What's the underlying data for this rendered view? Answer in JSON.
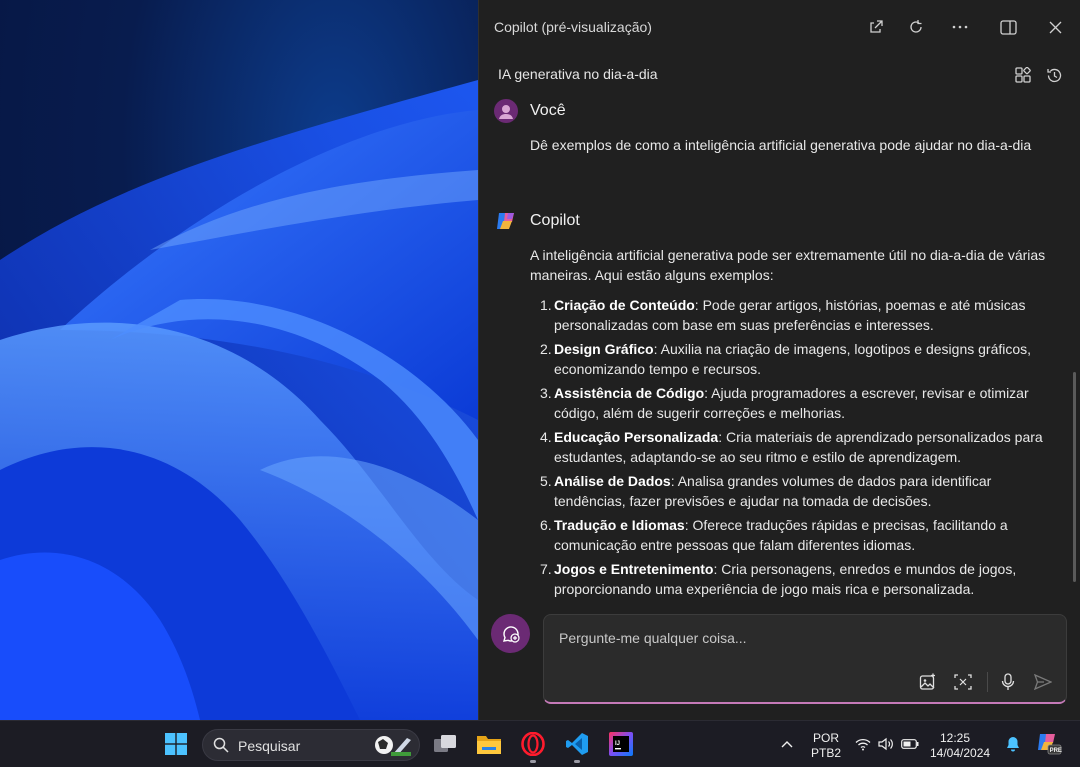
{
  "copilot": {
    "window_title": "Copilot (pré-visualização)",
    "conversation_title": "IA generativa no dia-a-dia",
    "user": {
      "name": "Você",
      "message": "Dê exemplos de como a inteligência artificial generativa pode ajudar no dia-a-dia"
    },
    "assistant": {
      "name": "Copilot",
      "intro": "A inteligência artificial generativa pode ser extremamente útil no dia-a-dia de várias maneiras. Aqui estão alguns exemplos:",
      "items": [
        {
          "num": "1.",
          "title": "Criação de Conteúdo",
          "text": ": Pode gerar artigos, histórias, poemas e até músicas personalizadas com base em suas preferências e interesses."
        },
        {
          "num": "2.",
          "title": "Design Gráfico",
          "text": ": Auxilia na criação de imagens, logotipos e designs gráficos, economizando tempo e recursos."
        },
        {
          "num": "3.",
          "title": "Assistência de Código",
          "text": ": Ajuda programadores a escrever, revisar e otimizar código, além de sugerir correções e melhorias."
        },
        {
          "num": "4.",
          "title": "Educação Personalizada",
          "text": ": Cria materiais de aprendizado personalizados para estudantes, adaptando-se ao seu ritmo e estilo de aprendizagem."
        },
        {
          "num": "5.",
          "title": "Análise de Dados",
          "text": ": Analisa grandes volumes de dados para identificar tendências, fazer previsões e ajudar na tomada de decisões."
        },
        {
          "num": "6.",
          "title": "Tradução e Idiomas",
          "text": ": Oferece traduções rápidas e precisas, facilitando a comunicação entre pessoas que falam diferentes idiomas."
        },
        {
          "num": "7.",
          "title": "Jogos e Entretenimento",
          "text": ": Cria personagens, enredos e mundos de jogos, proporcionando uma experiência de jogo mais rica e personalizada."
        }
      ]
    },
    "composer": {
      "placeholder": "Pergunte-me qualquer coisa..."
    },
    "icons": {
      "open_external": "open-external-icon",
      "refresh": "refresh-icon",
      "more": "more-icon",
      "dock": "dock-panel-icon",
      "close": "close-icon",
      "plugins": "plugins-icon",
      "history": "history-icon",
      "new_topic": "new-topic-icon",
      "add_image": "add-image-icon",
      "screenshot": "screenshot-icon",
      "mic": "microphone-icon",
      "send": "send-icon"
    },
    "colors": {
      "pane_bg": "#202020",
      "accent": "#c57ab8",
      "user_avatar": "#6b2a74"
    }
  },
  "taskbar": {
    "search_label": "Pesquisar",
    "language": "POR",
    "keyboard": "PTB2",
    "time": "12:25",
    "date": "14/04/2024",
    "copilot_badge": "PRE",
    "apps": [
      "start-icon",
      "search-icon",
      "task-view-icon",
      "file-explorer-icon",
      "opera-icon",
      "vscode-icon",
      "intellij-icon"
    ]
  }
}
